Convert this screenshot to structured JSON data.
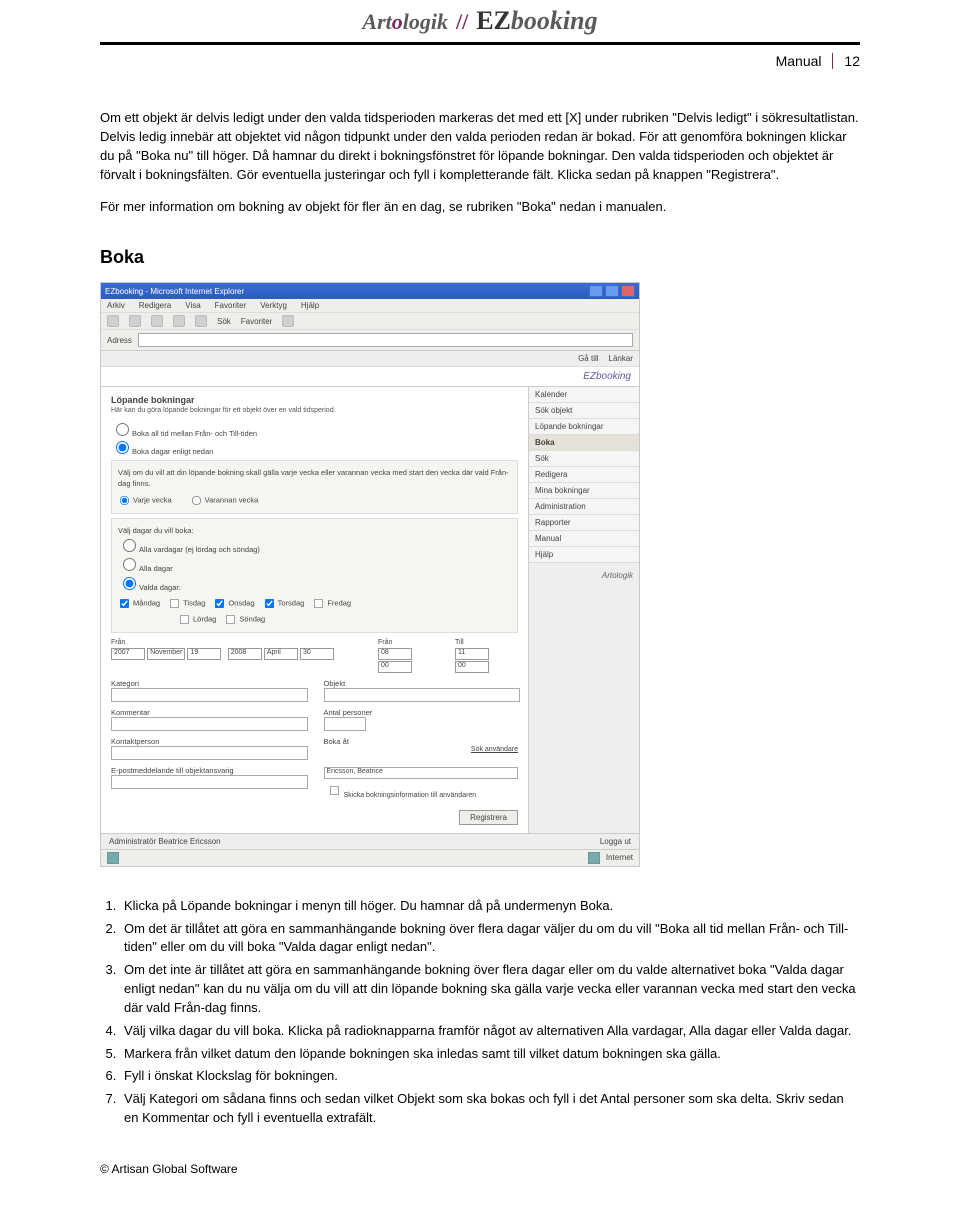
{
  "header": {
    "logo_art": "Art",
    "logo_o": "o",
    "logo_logik": "logik",
    "logo_sep": "//",
    "logo_ez_prefix": "EZ",
    "logo_ez_rest": "booking",
    "manual_label": "Manual",
    "page_number": "12"
  },
  "paragraphs": {
    "p1": "Om ett objekt är delvis ledigt under den valda tidsperioden markeras det med ett [X] under rubriken \"Delvis ledigt\" i sökresultatlistan. Delvis ledig innebär att objektet vid någon tidpunkt under den valda perioden redan är bokad. För att genomföra bokningen klickar du på \"Boka nu\" till höger. Då hamnar du direkt i bokningsfönstret för löpande bokningar. Den valda tidsperioden och objektet är förvalt i bokningsfälten. Gör eventuella justeringar och fyll i kompletterande fält. Klicka sedan på knappen \"Registrera\".",
    "p2": "För mer information om bokning av objekt för fler än en dag, se rubriken \"Boka\" nedan i manualen."
  },
  "section_title": "Boka",
  "screenshot": {
    "title": "EZbooking - Microsoft Internet Explorer",
    "menu": [
      "Arkiv",
      "Redigera",
      "Visa",
      "Favoriter",
      "Verktyg",
      "Hjälp"
    ],
    "toolbar_labels_sok": "Sök",
    "toolbar_labels_fav": "Favoriter",
    "address_label": "Adress",
    "top_strip": [
      "Gå till",
      "Länkar"
    ],
    "logo_text": "EZbooking",
    "nav": [
      "Kalender",
      "Sök objekt",
      "Löpande bokningar",
      "Boka",
      "Sök",
      "Redigera",
      "Mina bokningar",
      "Administration",
      "Rapporter",
      "Manual",
      "Hjälp"
    ],
    "nav_active_index": 3,
    "nav_footer_logo": "Artologik",
    "content": {
      "heading": "Löpande bokningar",
      "sub": "Här kan du göra löpande bokningar för ett objekt över en vald tidsperiod.",
      "opt_a": "Boka all tid mellan Från- och Till-tiden",
      "opt_b": "Boka dagar enligt nedan",
      "panel1_text": "Välj om du vill att din löpande bokning skall gälla varje vecka eller varannan vecka med start den vecka där vald Från-dag finns.",
      "r_varje": "Varje vecka",
      "r_varannan": "Varannan vecka",
      "panel2_text": "Välj dagar du vill boka:",
      "r_allavardagar": "Alla vardagar (ej lördag och söndag)",
      "r_alladagar": "Alla dagar",
      "r_valdadagar": "Valda dagar:",
      "days": [
        "Måndag",
        "Tisdag",
        "Onsdag",
        "Torsdag",
        "Fredag",
        "Lördag",
        "Söndag"
      ],
      "labels": {
        "fran": "Från",
        "till": "Till",
        "kategori": "Kategori",
        "objekt": "Objekt",
        "kommentar": "Kommentar",
        "antal": "Antal personer",
        "kontakt": "Kontaktperson",
        "bokat": "Boka åt",
        "epost": "E-postmeddelande till objektansvarig",
        "sok_anv": "Sök användare",
        "sand": "Skicka bokningsinformation till användaren"
      },
      "from_values": [
        "2007",
        "November",
        "19"
      ],
      "to_values": [
        "2008",
        "April",
        "30"
      ],
      "time_from": [
        "08",
        "00"
      ],
      "time_to": [
        "11",
        "00"
      ],
      "bokat_value": "Ericsson, Beatrice",
      "register_btn": "Registrera"
    },
    "footer": {
      "admin": "Administratör Beatrice Ericsson",
      "logout": "Logga ut",
      "status_internet": "Internet"
    }
  },
  "steps": [
    "Klicka på Löpande bokningar i menyn till höger. Du hamnar då på undermenyn Boka.",
    "Om det är tillåtet att göra en sammanhängande bokning över flera dagar väljer du om du vill \"Boka all tid mellan Från- och Till-tiden\" eller om du vill boka \"Valda dagar enligt nedan\".",
    "Om det inte är tillåtet att göra en sammanhängande bokning över flera dagar eller om du valde alternativet boka \"Valda dagar enligt nedan\" kan du nu välja om du vill att din löpande bokning ska gälla varje vecka eller varannan vecka med start den vecka där vald Från-dag finns.",
    "Välj vilka dagar du vill boka. Klicka på radioknapparna framför något av alternativen Alla vardagar, Alla dagar eller Valda dagar.",
    "Markera från vilket datum den löpande bokningen ska inledas samt till vilket datum bokningen ska gälla.",
    "Fyll i önskat Klockslag för bokningen.",
    "Välj Kategori om sådana finns och sedan vilket Objekt som ska bokas och fyll i det Antal personer som ska delta. Skriv sedan en Kommentar och fyll i eventuella extrafält."
  ],
  "footer_text": "© Artisan Global Software"
}
